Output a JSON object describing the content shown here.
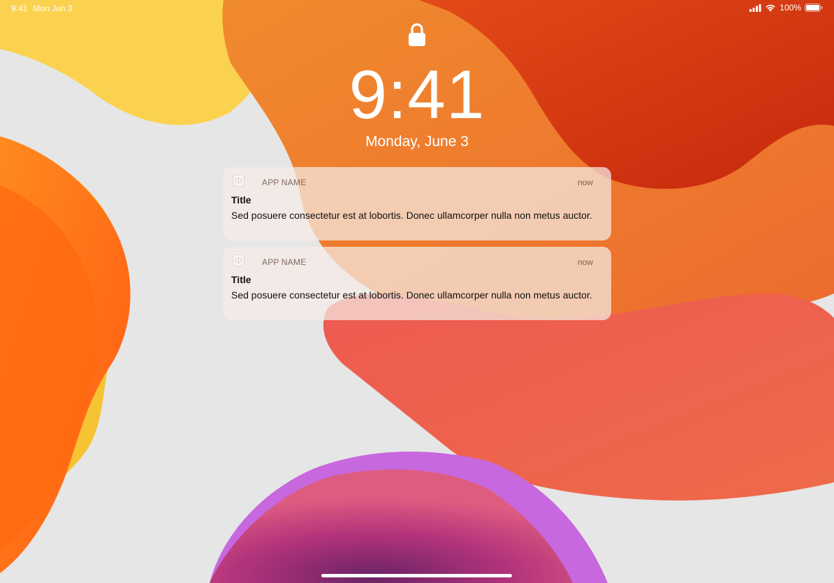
{
  "status_bar": {
    "time": "9:41",
    "date": "Mon Jun 3",
    "battery": "100%",
    "icons": [
      "cellular-signal-icon",
      "wifi-icon",
      "battery-icon"
    ]
  },
  "lock_screen": {
    "lock_icon": "lock-icon",
    "clock": "9:41",
    "date": "Monday, June 3"
  },
  "notifications": [
    {
      "app_name": "APP NAME",
      "time": "now",
      "title": "Title",
      "body": "Sed posuere consectetur est at lobortis. Donec ullamcorper nulla non metus auctor.",
      "icon": "app-icon"
    },
    {
      "app_name": "APP NAME",
      "time": "now",
      "title": "Title",
      "body": "Sed posuere consectetur est at lobortis. Donec ullamcorper nulla non metus auctor.",
      "icon": "app-icon"
    }
  ],
  "colors": {
    "accent_orange": "#ee7a2e",
    "accent_red": "#cc2a0c",
    "accent_yellow": "#fbd14a",
    "accent_pink": "#ee5068",
    "accent_purple": "#c86ee0",
    "background": "#e6e6e6"
  }
}
